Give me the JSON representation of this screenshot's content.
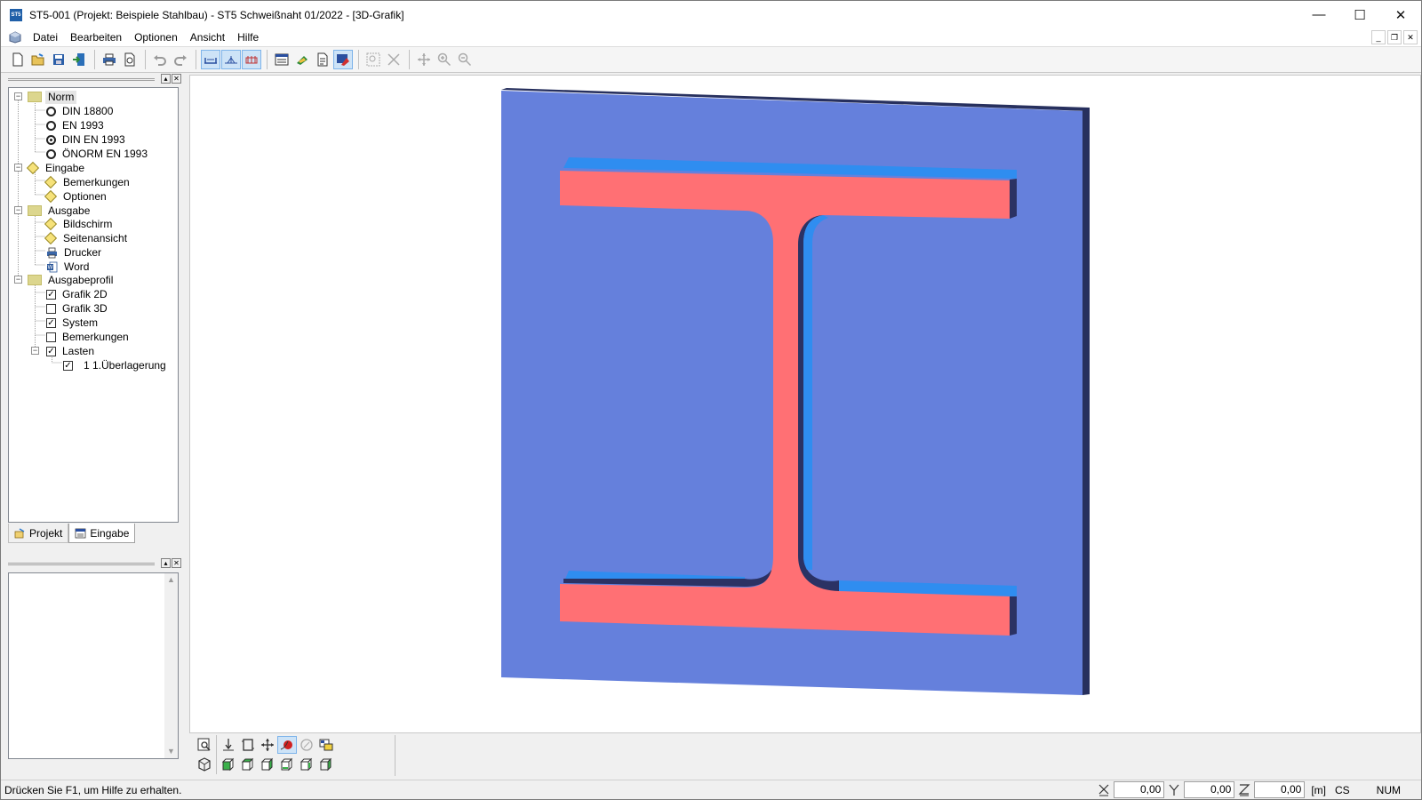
{
  "window": {
    "title": "ST5-001 (Projekt: Beispiele Stahlbau) - ST5 Schweißnaht 01/2022 - [3D-Grafik]",
    "app_icon_text": "ST5",
    "minimize": "—",
    "maximize": "☐",
    "close": "✕"
  },
  "menu": {
    "items": [
      "Datei",
      "Bearbeiten",
      "Optionen",
      "Ansicht",
      "Hilfe"
    ],
    "mdi_min": "_",
    "mdi_restore": "❐",
    "mdi_close": "✕"
  },
  "tree": {
    "norm": "Norm",
    "norm_items": [
      "DIN 18800",
      "EN 1993",
      "DIN EN 1993",
      "ÖNORM EN 1993"
    ],
    "norm_selected": 2,
    "eingabe": "Eingabe",
    "eingabe_items": [
      "Bemerkungen",
      "Optionen"
    ],
    "ausgabe": "Ausgabe",
    "ausgabe_items": [
      "Bildschirm",
      "Seitenansicht",
      "Drucker",
      "Word"
    ],
    "ausgabeprofil": "Ausgabeprofil",
    "profil_items": [
      {
        "label": "Grafik 2D",
        "checked": true
      },
      {
        "label": "Grafik 3D",
        "checked": false
      },
      {
        "label": "System",
        "checked": true
      },
      {
        "label": "Bemerkungen",
        "checked": false
      },
      {
        "label": "Lasten",
        "checked": true
      }
    ],
    "lasten_child": "1 1.Überlagerung",
    "check_mark": "✓",
    "minus": "−"
  },
  "tabs": {
    "projekt": "Projekt",
    "eingabe": "Eingabe"
  },
  "pane_buttons": {
    "pin": "▴",
    "close": "✕"
  },
  "scroll": {
    "up": "▲",
    "down": "▼"
  },
  "colors": {
    "plate": "#6580dc",
    "plate_edge": "#27305e",
    "section": "#ff7074",
    "section_light": "#2f8df0",
    "section_dark": "#2b3264"
  },
  "status": {
    "help_text": "Drücken Sie F1, um Hilfe zu erhalten.",
    "x": "0,00",
    "y": "0,00",
    "z": "0,00",
    "unit": "[m]",
    "cs": "CS",
    "num": "NUM"
  }
}
